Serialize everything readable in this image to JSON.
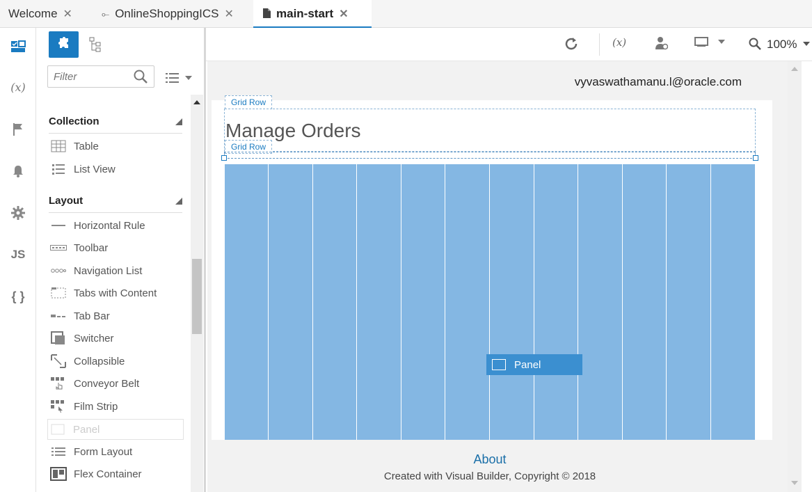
{
  "tabs": [
    {
      "label": "Welcome",
      "icon": "none"
    },
    {
      "label": "OnlineShoppingICS",
      "icon": "git-commit-icon"
    },
    {
      "label": "main-start",
      "icon": "file-icon"
    }
  ],
  "rail": [
    "page-designer-icon",
    "variables-icon",
    "flag-icon",
    "bell-icon",
    "gear-icon",
    "javascript-icon",
    "json-icon"
  ],
  "rail_labels": {
    "variables": "(x)",
    "js": "JS",
    "json": "{ }"
  },
  "palette": {
    "filter_placeholder": "Filter",
    "sections": [
      {
        "title": "Collection",
        "items": [
          "Table",
          "List View"
        ]
      },
      {
        "title": "Layout",
        "items": [
          "Horizontal Rule",
          "Toolbar",
          "Navigation List",
          "Tabs with Content",
          "Tab Bar",
          "Switcher",
          "Collapsible",
          "Conveyor Belt",
          "Film Strip",
          "Panel",
          "Form Layout",
          "Flex Container"
        ]
      }
    ]
  },
  "toolbar": {
    "zoom": "100%"
  },
  "page": {
    "user": "vyvaswathamanu.l@oracle.com",
    "gridrow_label_1": "Grid Row",
    "gridrow_label_2": "Grid Row",
    "title": "Manage Orders",
    "panel_label": "Panel",
    "about": "About",
    "copyright": "Created with Visual Builder, Copyright © 2018"
  },
  "colors": {
    "accent": "#1a7bc1",
    "grid": "#84b7e3",
    "panel": "#3b8fd0"
  }
}
